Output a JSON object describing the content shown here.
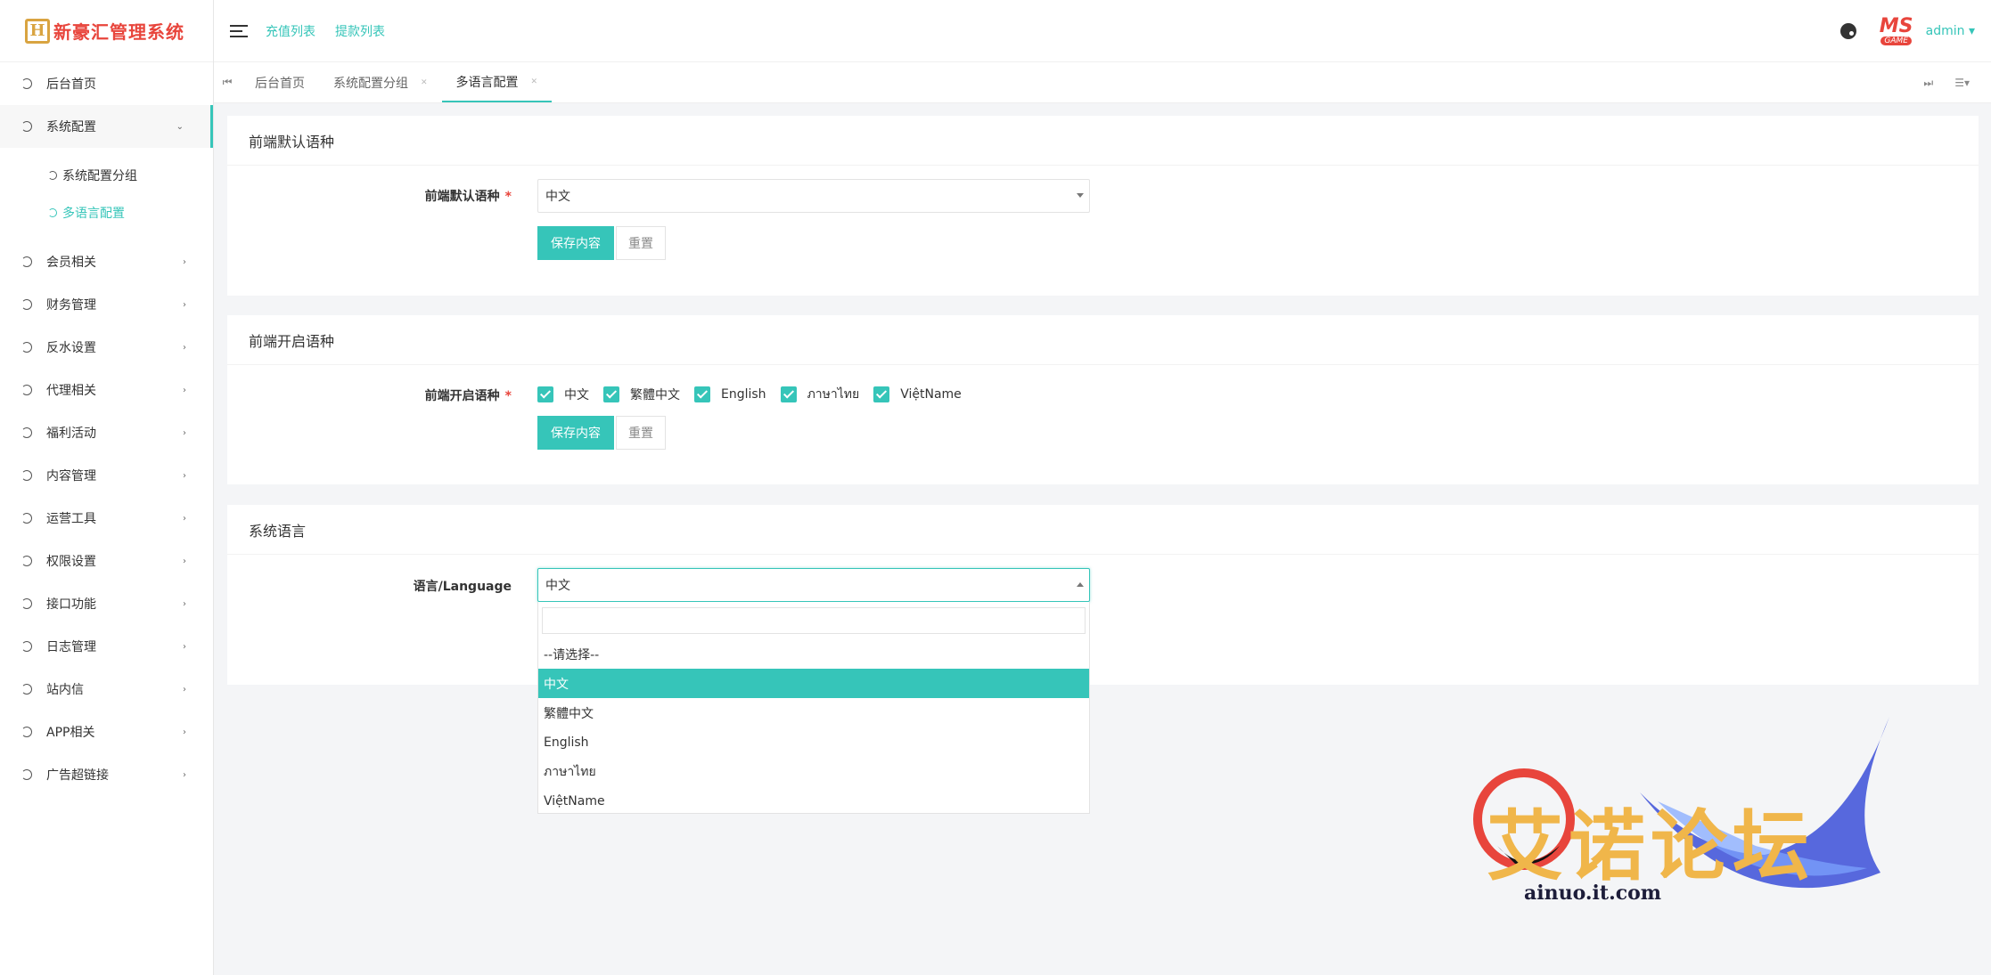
{
  "brand": {
    "logo_mark": "H",
    "title": "新豪汇管理系统"
  },
  "sidebar": {
    "items": [
      {
        "label": "后台首页"
      },
      {
        "label": "系统配置"
      },
      {
        "label": "会员相关"
      },
      {
        "label": "财务管理"
      },
      {
        "label": "反水设置"
      },
      {
        "label": "代理相关"
      },
      {
        "label": "福利活动"
      },
      {
        "label": "内容管理"
      },
      {
        "label": "运营工具"
      },
      {
        "label": "权限设置"
      },
      {
        "label": "接口功能"
      },
      {
        "label": "日志管理"
      },
      {
        "label": "站内信"
      },
      {
        "label": "APP相关"
      },
      {
        "label": "广告超链接"
      }
    ],
    "sub_items": [
      {
        "label": "系统配置分组"
      },
      {
        "label": "多语言配置"
      }
    ]
  },
  "header": {
    "links": [
      "充值列表",
      "提款列表"
    ],
    "avatar_top": "MS",
    "avatar_bottom": "GAME",
    "user": "admin"
  },
  "tabs": [
    {
      "label": "后台首页"
    },
    {
      "label": "系统配置分组"
    },
    {
      "label": "多语言配置"
    }
  ],
  "panel1": {
    "title": "前端默认语种",
    "label": "前端默认语种",
    "required": "*",
    "value": "中文",
    "save": "保存内容",
    "reset": "重置"
  },
  "panel2": {
    "title": "前端开启语种",
    "label": "前端开启语种",
    "required": "*",
    "options": [
      "中文",
      "繁體中文",
      "English",
      "ภาษาไทย",
      "ViệtName"
    ],
    "save": "保存内容",
    "reset": "重置"
  },
  "panel3": {
    "title": "系统语言",
    "label": "语言/Language",
    "value": "中文",
    "dropdown": [
      "--请选择--",
      "中文",
      "繁體中文",
      "English",
      "ภาษาไทย",
      "ViệtName"
    ]
  },
  "watermark": {
    "text": "艾诺论坛",
    "url": "ainuo.it.com"
  },
  "colors": {
    "accent": "#36c5b9",
    "brand_red": "#e8453c",
    "brand_gold": "#d9a441"
  }
}
